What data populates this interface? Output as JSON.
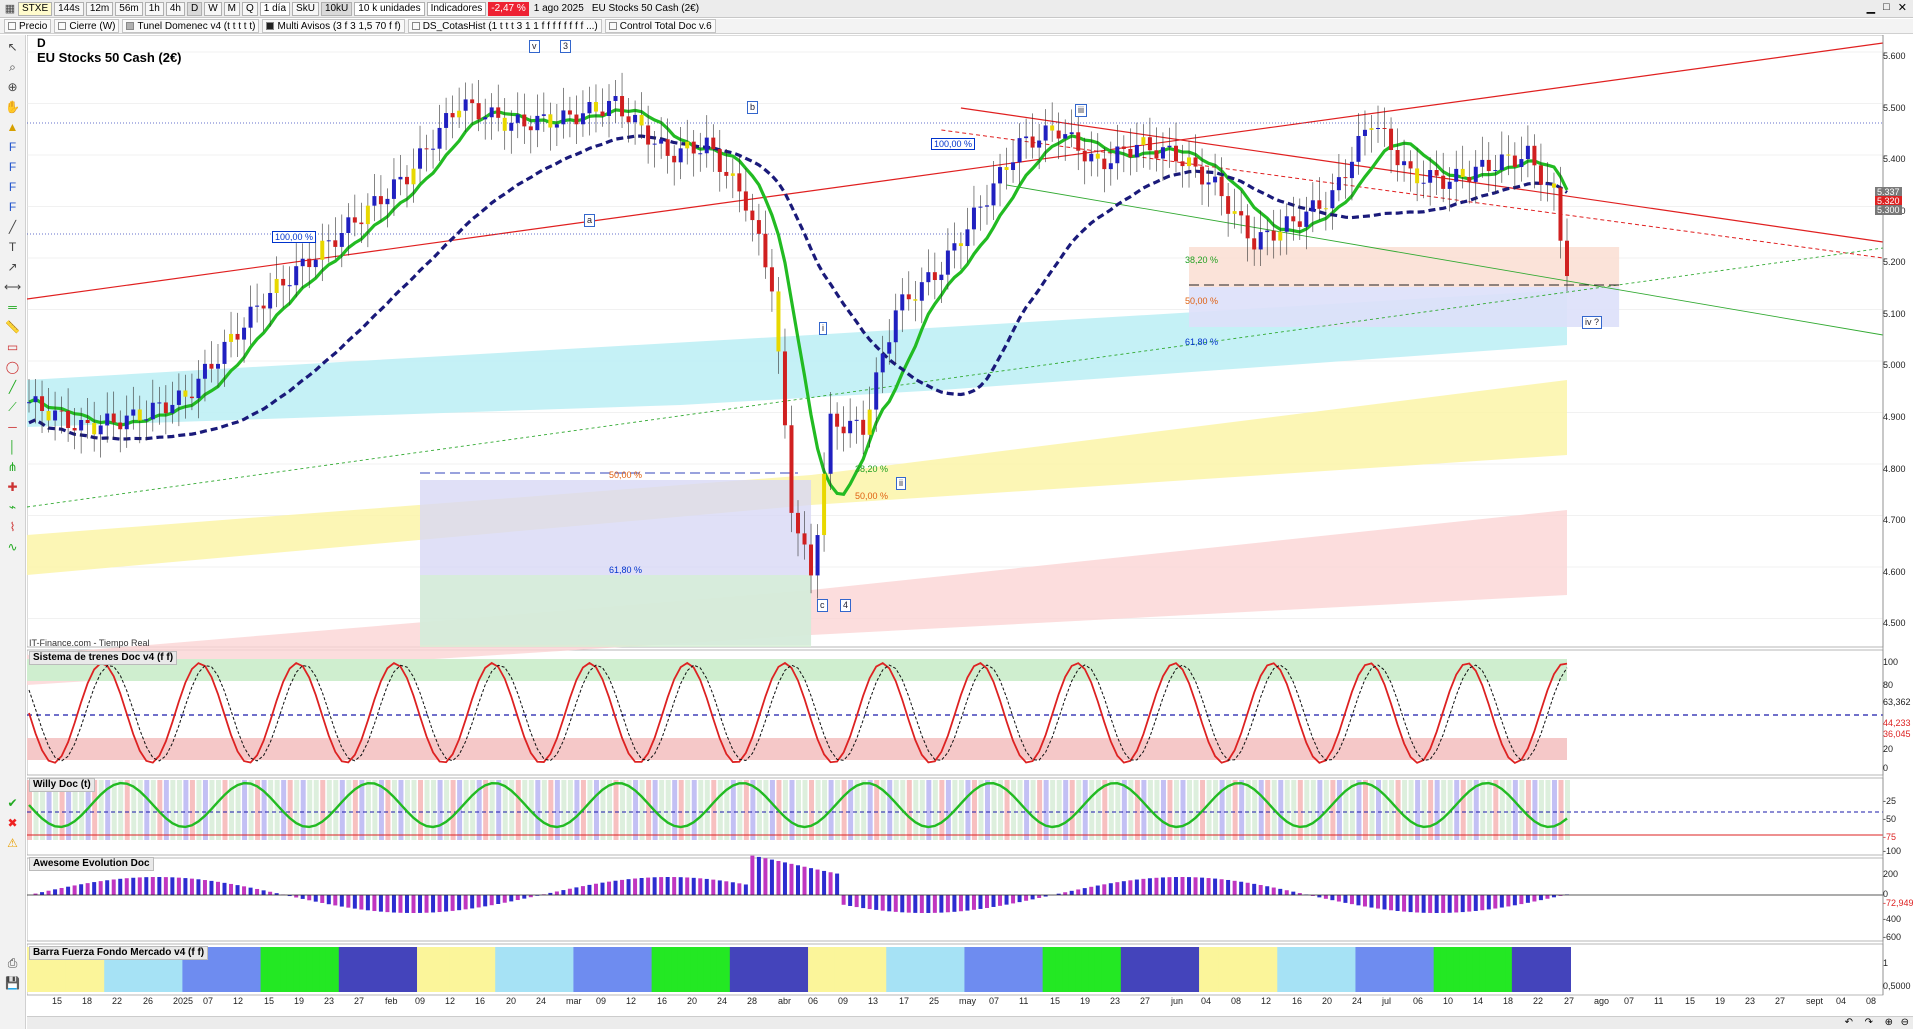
{
  "toolbar": {
    "symbol": "STXE",
    "timeframes": [
      "144s",
      "12m",
      "56m",
      "1h",
      "4h",
      "D",
      "W",
      "M",
      "Q"
    ],
    "interval_select": "1 día",
    "flags": [
      "SkU",
      "10kU"
    ],
    "units_select": "10 k unidades",
    "indicators_label": "Indicadores",
    "change": "-2,47 %",
    "date": "1 ago 2025",
    "instrument": "EU Stocks 50 Cash (2€)"
  },
  "indicator_tabs": [
    "Precio",
    "Cierre (W)",
    "Tunel Domenec v4 (t t t t t)",
    "Multi Avisos (3 f 3 1,5 70 f f)",
    "DS_CotasHist (1 t t t 3 1 1 f f f f f f f f ...)",
    "Control Total Doc v.6"
  ],
  "main_chart": {
    "period_letter": "D",
    "title": "EU Stocks 50 Cash (2€)",
    "source": "IT-Finance.com - Tiempo Real",
    "y_ticks": [
      "5.600",
      "5.500",
      "5.400",
      "5.300",
      "5.200",
      "5.100",
      "5.000",
      "4.900",
      "4.800",
      "4.700",
      "4.600",
      "4.500"
    ],
    "price_tags": [
      {
        "text": "5.337",
        "color": "#7a7a7a"
      },
      {
        "text": "5.320",
        "color": "#d22"
      },
      {
        "text": "5.300",
        "color": "#777"
      }
    ],
    "wave_labels": [
      "v",
      "3",
      "b",
      "a",
      "iii",
      "i",
      "ii",
      "c",
      "4",
      "iv ?"
    ],
    "fib_labels": [
      {
        "text": "100,00 %",
        "color": "#0033cc"
      },
      {
        "text": "100,00 %",
        "color": "#0033cc"
      },
      {
        "text": "50,00 %",
        "color": "#e06010"
      },
      {
        "text": "61,80 %",
        "color": "#0033cc"
      },
      {
        "text": "38,20 %",
        "color": "#20a020"
      },
      {
        "text": "50,00 %",
        "color": "#e06010"
      },
      {
        "text": "38,20 %",
        "color": "#20a020"
      },
      {
        "text": "50,00 %",
        "color": "#e06010"
      },
      {
        "text": "61,80 %",
        "color": "#0033cc"
      }
    ]
  },
  "panels": [
    {
      "title": "Sistema de trenes Doc v4 (f f)",
      "ticks": [
        "100",
        "80",
        "63,362",
        "44,233",
        "36,045",
        "20",
        "0"
      ]
    },
    {
      "title": "Willy Doc (t)",
      "ticks": [
        "-25",
        "-50",
        "-75",
        "-100"
      ]
    },
    {
      "title": "Awesome Evolution Doc",
      "ticks": [
        "200",
        "0",
        "-72,949",
        "-400",
        "-600"
      ]
    },
    {
      "title": "Barra Fuerza Fondo Mercado v4 (f f)",
      "ticks": [
        "1",
        "0,5000"
      ]
    }
  ],
  "x_axis": [
    "15",
    "18",
    "22",
    "26",
    "2025",
    "07",
    "12",
    "15",
    "19",
    "23",
    "27",
    "feb",
    "09",
    "12",
    "16",
    "20",
    "24",
    "mar",
    "09",
    "12",
    "16",
    "20",
    "24",
    "28",
    "abr",
    "06",
    "09",
    "13",
    "17",
    "25",
    "may",
    "07",
    "11",
    "15",
    "19",
    "23",
    "27",
    "jun",
    "04",
    "08",
    "12",
    "16",
    "20",
    "24",
    "jul",
    "06",
    "10",
    "14",
    "18",
    "22",
    "27",
    "ago",
    "07",
    "11",
    "15",
    "19",
    "23",
    "27",
    "sept",
    "04",
    "08"
  ],
  "colors": {
    "up": "#2020c0",
    "down": "#d02020",
    "green_line": "#22bb22",
    "navy_dash": "#1a1a7a"
  }
}
